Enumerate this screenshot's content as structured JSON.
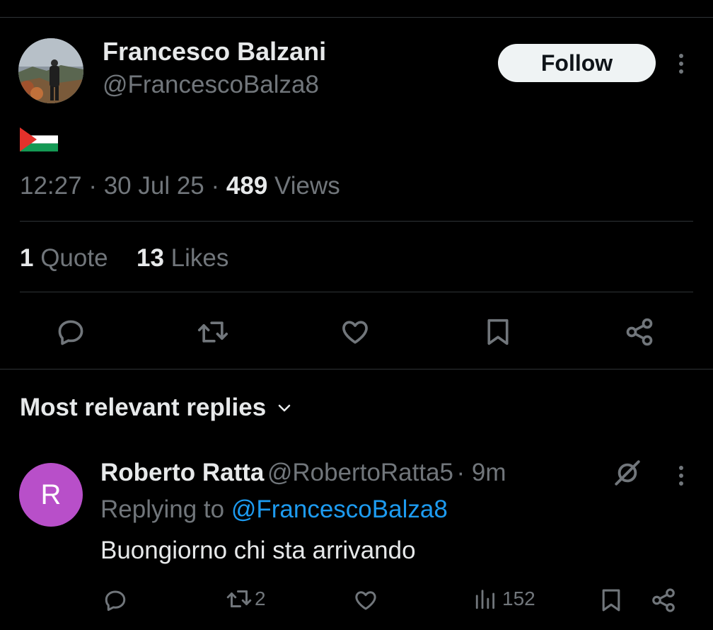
{
  "post": {
    "author_name": "Francesco Balzani",
    "author_handle": "@FrancescoBalza8",
    "follow_label": "Follow",
    "content_emoji": "palestine-flag",
    "time": "12:27",
    "date": "30 Jul 25",
    "views_count": "489",
    "views_label": "Views",
    "quotes_count": "1",
    "quotes_label": "Quote",
    "likes_count": "13",
    "likes_label": "Likes"
  },
  "actions": [
    "reply-icon",
    "repost-icon",
    "like-icon",
    "bookmark-icon",
    "share-icon"
  ],
  "replies_section": {
    "title": "Most relevant replies"
  },
  "reply": {
    "avatar_letter": "R",
    "avatar_color": "#b84fc9",
    "name": "Roberto Ratta",
    "handle": "@RobertoRatta5",
    "time": "9m",
    "replying_label": "Replying to",
    "replying_to": "@FrancescoBalza8",
    "text": "Buongiorno chi sta arrivando",
    "reposts": "2",
    "views": "152"
  },
  "colors": {
    "background": "#000000",
    "text": "#e7e9ea",
    "secondary": "#71767b",
    "link": "#1d9bf0",
    "divider": "#2f3336"
  }
}
